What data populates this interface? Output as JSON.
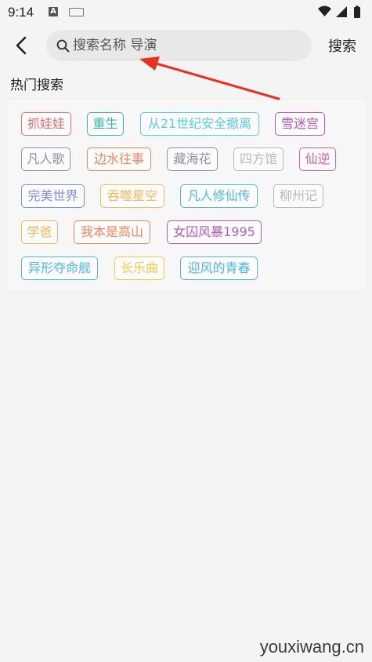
{
  "status_bar": {
    "time": "9:14",
    "icons": [
      "a-notification-icon",
      "keyboard-icon",
      "wifi-icon",
      "cell-signal-icon",
      "battery-icon"
    ]
  },
  "search": {
    "placeholder": "搜索名称 导演",
    "value": "",
    "button_label": "搜索"
  },
  "hot_search": {
    "title": "热门搜索",
    "tags": [
      {
        "label": "抓娃娃",
        "color": "#e8706f"
      },
      {
        "label": "重生",
        "color": "#3fb6a1"
      },
      {
        "label": "从21世纪安全撤离",
        "color": "#57cde1"
      },
      {
        "label": "雪迷宫",
        "color": "#b55ac7"
      },
      {
        "label": "凡人歌",
        "color": "#8e959d"
      },
      {
        "label": "边水往事",
        "color": "#f0885f"
      },
      {
        "label": "藏海花",
        "color": "#8e959d"
      },
      {
        "label": "四方馆",
        "color": "#b8b8b8"
      },
      {
        "label": "仙逆",
        "color": "#e0609a"
      },
      {
        "label": "完美世界",
        "color": "#7f8de8"
      },
      {
        "label": "吞噬星空",
        "color": "#f5ba58"
      },
      {
        "label": "凡人修仙传",
        "color": "#4fb7e8"
      },
      {
        "label": "柳州记",
        "color": "#b8b8b8"
      },
      {
        "label": "学爸",
        "color": "#f5ba58"
      },
      {
        "label": "我本是高山",
        "color": "#f0885f"
      },
      {
        "label": "女囚风暴1995",
        "color": "#b55ac7"
      },
      {
        "label": "异形夺命舰",
        "color": "#4fb7e8"
      },
      {
        "label": "长乐曲",
        "color": "#f5c84a"
      },
      {
        "label": "迎风的青春",
        "color": "#4fb7e8"
      }
    ]
  },
  "annotation": {
    "arrow_color": "#e8311f"
  },
  "watermark": "youxiwang.cn"
}
